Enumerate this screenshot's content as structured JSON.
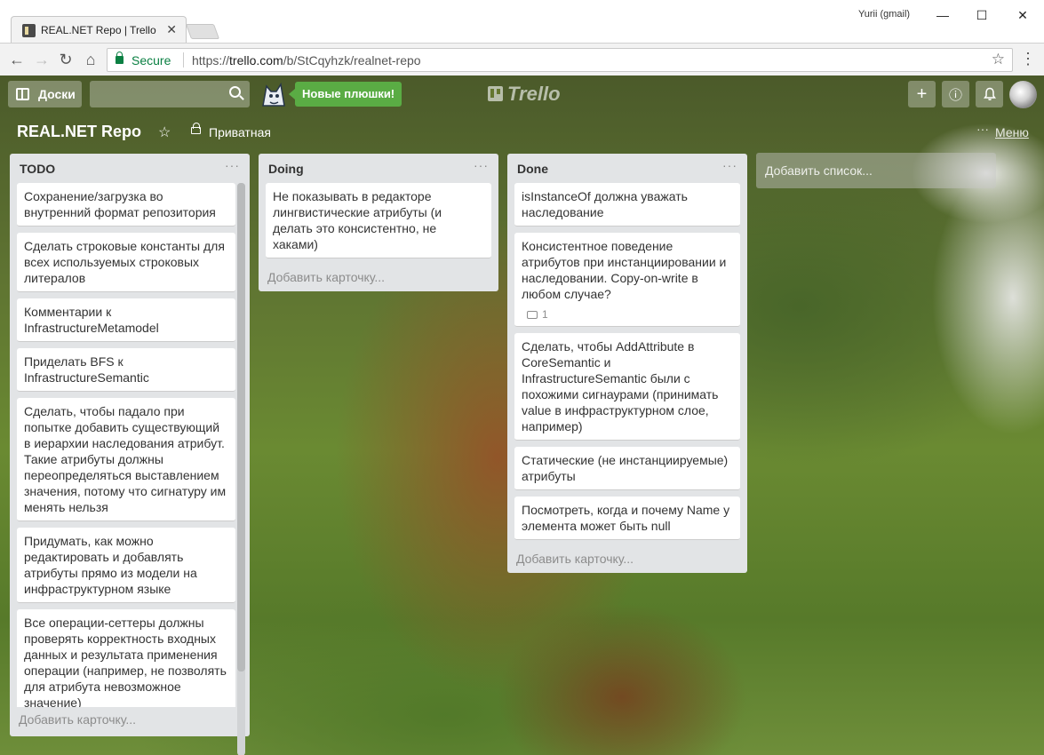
{
  "browser": {
    "tab_title": "REAL.NET Repo | Trello",
    "profile": "Yurii (gmail)",
    "secure_label": "Secure",
    "url_prefix": "https://",
    "url_host": "trello.com",
    "url_path": "/b/StCqyhzk/realnet-repo"
  },
  "app": {
    "boards_label": "Доски",
    "search_placeholder": "",
    "promo_label": "Новые плюшки!",
    "logo_text": "Trello",
    "accent_green": "#5aac44"
  },
  "board": {
    "title": "REAL.NET Repo",
    "visibility": "Приватная",
    "menu_label": "Меню",
    "add_list_label": "Добавить список..."
  },
  "lists": [
    {
      "title": "TODO",
      "add_card_label": "Добавить карточку...",
      "cards": [
        "Сохранение/загрузка во внутренний формат репозитория",
        "Сделать строковые константы для всех используемых строковых литералов",
        "Комментарии к InfrastructureMetamodel",
        "Приделать BFS к InfrastructureSemantic",
        "Сделать, чтобы падало при попытке добавить существующий в иерархии наследования атрибут. Такие атрибуты должны переопределяться выставлением значения, потому что сигнатуру им менять нельзя",
        "Придумать, как можно редактировать и добавлять атрибуты прямо из модели на инфраструктурном языке",
        "Все операции-сеттеры должны проверять корректность входных данных и результата применения операции (например, не позволять для атрибута невозможное значение)"
      ]
    },
    {
      "title": "Doing",
      "add_card_label": "Добавить карточку...",
      "cards": [
        "Не показывать в редакторе лингвистические атрибуты (и делать это консистентно, не хаками)"
      ]
    },
    {
      "title": "Done",
      "add_card_label": "Добавить карточку...",
      "cards": [
        "isInstanceOf должна уважать наследование",
        "Консистентное поведение атрибутов при инстанциировании и наследовании. Copy-on-write в любом случае?",
        "Сделать, чтобы AddAttribute в CoreSemantic и InfrastructureSemantic были с похожими сигнаурами (принимать value в инфраструктурном слое, например)",
        "Статические (не инстанциируемые) атрибуты",
        "Посмотреть, когда и почему Name у элемента может быть null"
      ],
      "card_comment_count": "1"
    }
  ]
}
